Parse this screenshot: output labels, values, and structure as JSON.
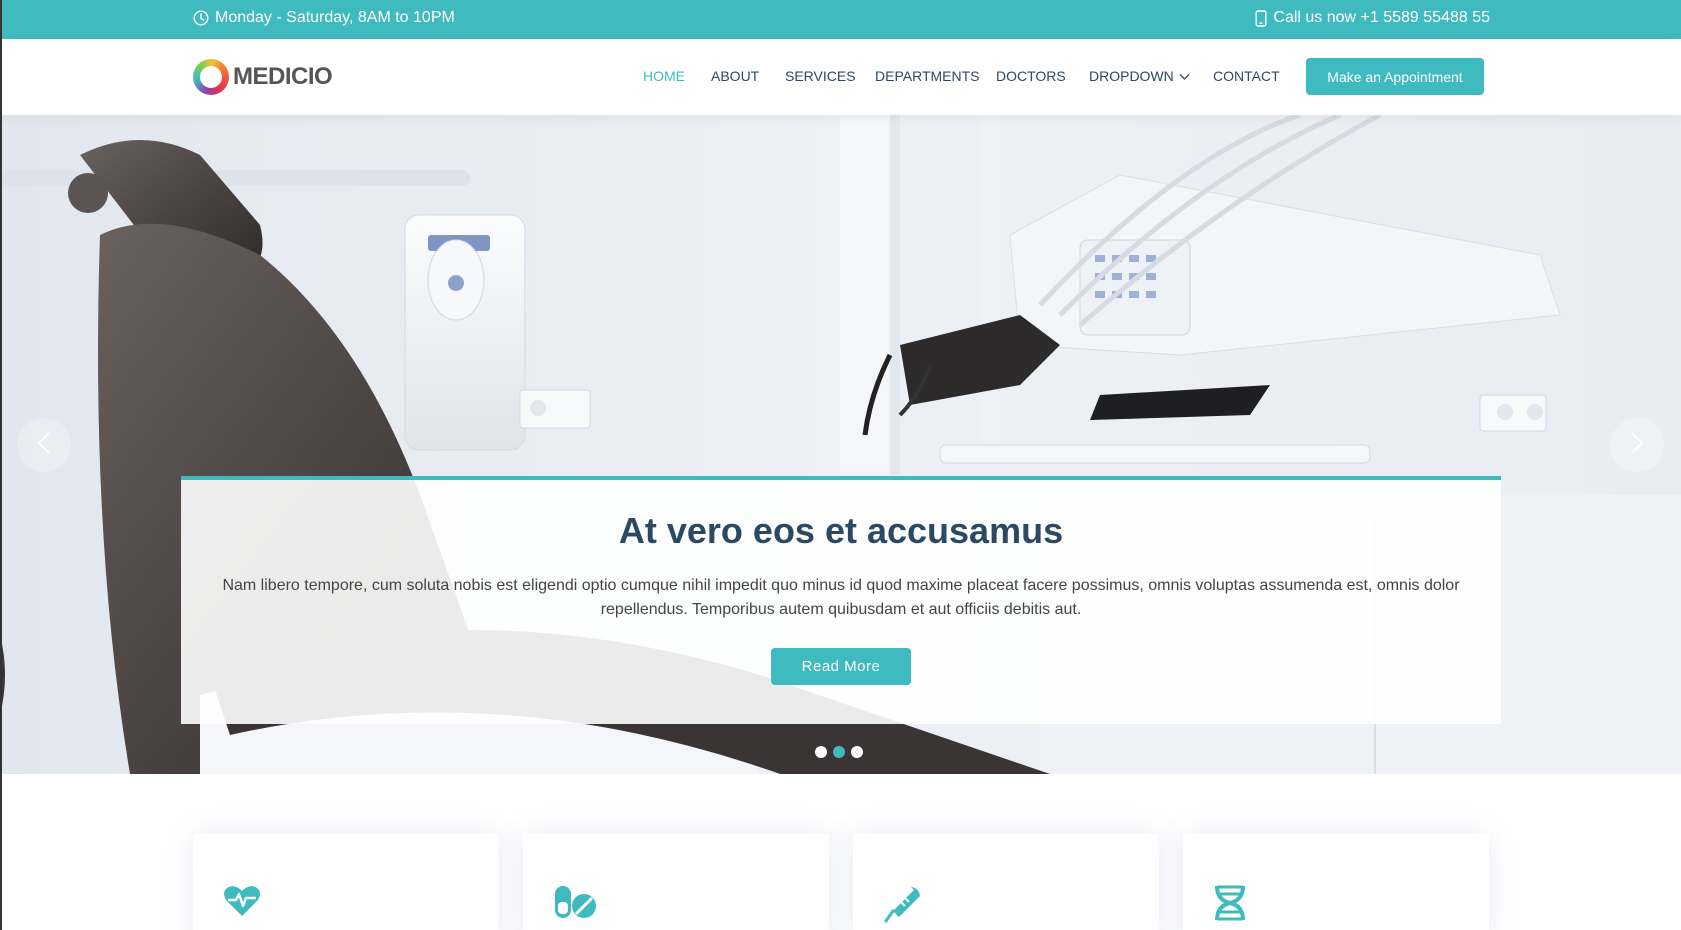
{
  "topbar": {
    "hours_icon": "clock-icon",
    "hours": "Monday - Saturday, 8AM to 10PM",
    "phone_icon": "phone-icon",
    "phone": "Call us now +1 5589 55488 55"
  },
  "header": {
    "logo_text": "MEDICIO",
    "nav": [
      {
        "label": "HOME",
        "active": true
      },
      {
        "label": "ABOUT",
        "active": false
      },
      {
        "label": "SERVICES",
        "active": false
      },
      {
        "label": "DEPARTMENTS",
        "active": false
      },
      {
        "label": "DOCTORS",
        "active": false
      },
      {
        "label": "DROPDOWN",
        "active": false
      },
      {
        "label": "CONTACT",
        "active": false
      }
    ],
    "appointment_label": "Make an Appointment"
  },
  "hero": {
    "title": "At vero eos et accusamus",
    "text": "Nam libero tempore, cum soluta nobis est eligendi optio cumque nihil impedit quo minus id quod maxime placeat facere possimus, omnis voluptas assumenda est, omnis dolor repellendus. Temporibus autem quibusdam et aut officiis debitis aut.",
    "button_label": "Read More",
    "slides_count": 3,
    "active_slide": 2
  },
  "features": {
    "icons": [
      "heart-pulse-icon",
      "capsule-pill-icon",
      "thermometer-icon",
      "dna-icon"
    ]
  },
  "colors": {
    "accent": "#3fbbc0",
    "heading": "#2c4964"
  }
}
